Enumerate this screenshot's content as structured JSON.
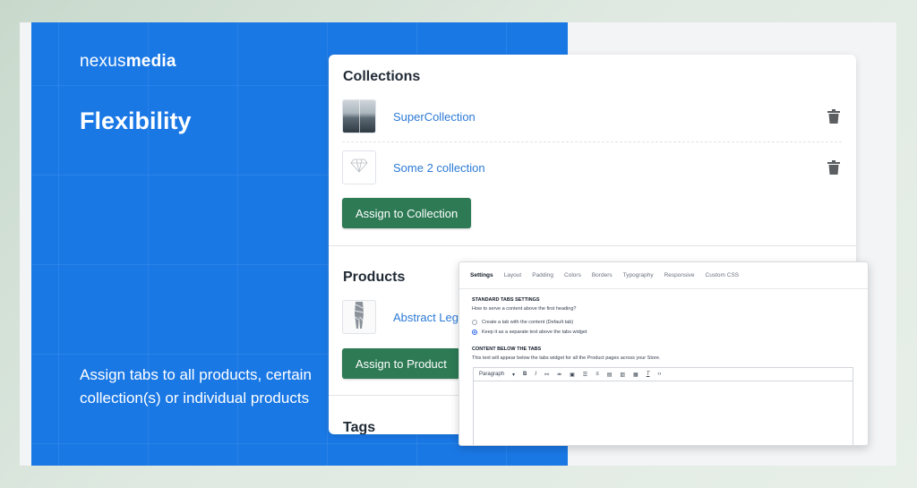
{
  "brand": {
    "logo_light": "nexus",
    "logo_bold": "media"
  },
  "hero": {
    "headline": "Flexibility",
    "description": "Assign tabs to all products, certain collection(s) or individual products"
  },
  "collections": {
    "title": "Collections",
    "items": [
      {
        "name": "SuperCollection",
        "thumb": "sea-photo"
      },
      {
        "name": "Some 2 collection",
        "thumb": "diamond-icon"
      }
    ],
    "assign_label": "Assign to Collection"
  },
  "products": {
    "title": "Products",
    "items": [
      {
        "name": "Abstract Leg",
        "thumb": "leggings-photo"
      }
    ],
    "assign_label": "Assign to Product"
  },
  "tags": {
    "title": "Tags"
  },
  "settings_panel": {
    "tabs": [
      "Settings",
      "Layout",
      "Padding",
      "Colors",
      "Borders",
      "Typography",
      "Responsive",
      "Custom CSS"
    ],
    "active_tab": "Settings",
    "standard_heading": "STANDARD TABS SETTINGS",
    "standard_question": "How to serve a content above the first heading?",
    "options": [
      {
        "label": "Create a tab with the content (Default tab)",
        "selected": false
      },
      {
        "label": "Keep it as a separate text above the tabs widget",
        "selected": true
      }
    ],
    "content_heading": "CONTENT BELOW THE TABS",
    "content_note": "This text will appear below the tabs widget for all the Product pages across your Store.",
    "editor": {
      "format_label": "Paragraph"
    }
  },
  "colors": {
    "brand_blue": "#1a78e5",
    "button_green": "#2d7a55",
    "link_blue": "#2c7ad6"
  }
}
